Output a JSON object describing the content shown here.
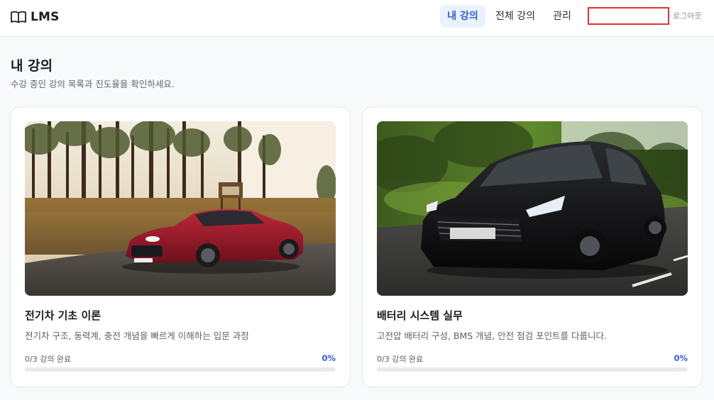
{
  "header": {
    "brand": "LMS",
    "nav": [
      {
        "label": "내 강의",
        "active": true
      },
      {
        "label": "전체 강의",
        "active": false
      },
      {
        "label": "관리",
        "active": false
      }
    ],
    "user_field": "",
    "logout_label": "로그아웃"
  },
  "page": {
    "title": "내 강의",
    "subtitle": "수강 중인 강의 목록과 진도율을 확인하세요."
  },
  "courses": [
    {
      "title": "전기차 기초 이론",
      "description": "전기차 구조, 동력계, 충전 개념을 빠르게 이해하는 입문 과정",
      "progress_text": "0/3 강의 완료",
      "progress_percent": "0%",
      "progress": 0,
      "thumbnail": "red-sports-car-in-forest"
    },
    {
      "title": "배터리 시스템 실무",
      "description": "고전압 배터리 구성, BMS 개념, 안전 점검 포인트를 다룹니다.",
      "progress_text": "0/3 강의 완료",
      "progress_percent": "0%",
      "progress": 0,
      "thumbnail": "black-sedan-on-road"
    }
  ],
  "colors": {
    "accent": "#2d5fd3",
    "nav_active_bg": "#eaf1ff",
    "highlight_border": "#e03131"
  }
}
